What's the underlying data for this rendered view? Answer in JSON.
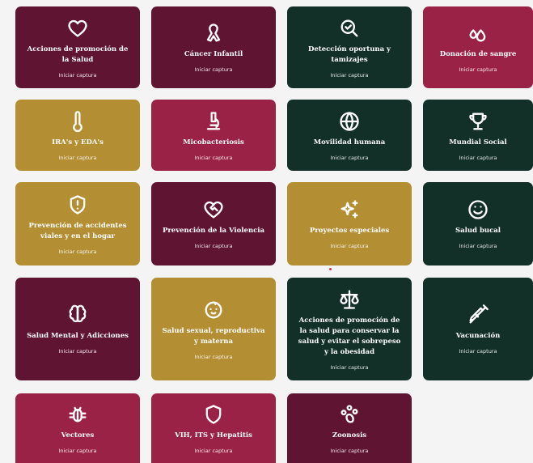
{
  "cards": [
    {
      "title": "Acciones de promoción de la Salud",
      "cta": "Iniciar captura",
      "icon": "heart-icon",
      "color": "#5f1432"
    },
    {
      "title": "Cáncer Infantil",
      "cta": "Iniciar captura",
      "icon": "ribbon-icon",
      "color": "#5f1432"
    },
    {
      "title": "Detección oportuna y tamizajes",
      "cta": "Iniciar captura",
      "icon": "search-check-icon",
      "color": "#133028"
    },
    {
      "title": "Donación de sangre",
      "cta": "Iniciar captura",
      "icon": "droplets-icon",
      "color": "#9b2247"
    },
    {
      "title": "IRA's y EDA's",
      "cta": "Iniciar captura",
      "icon": "thermometer-icon",
      "color": "#b38e33"
    },
    {
      "title": "Micobacteriosis",
      "cta": "Iniciar captura",
      "icon": "microscope-icon",
      "color": "#9b2247"
    },
    {
      "title": "Movilidad humana",
      "cta": "Iniciar captura",
      "icon": "globe-icon",
      "color": "#133028"
    },
    {
      "title": "Mundial Social",
      "cta": "Iniciar captura",
      "icon": "trophy-icon",
      "color": "#133028"
    },
    {
      "title": "Prevención de accidentes viales y en el hogar",
      "cta": "Iniciar captura",
      "icon": "shield-alert-icon",
      "color": "#b38e33"
    },
    {
      "title": "Prevención de la Violencia",
      "cta": "Iniciar captura",
      "icon": "heart-handshake-icon",
      "color": "#5f1432"
    },
    {
      "title": "Proyectos especiales",
      "cta": "Iniciar captura",
      "icon": "sparkles-icon",
      "color": "#b38e33"
    },
    {
      "title": "Salud bucal",
      "cta": "Iniciar captura",
      "icon": "smile-icon",
      "color": "#133028"
    },
    {
      "title": "Salud Mental y Adicciones",
      "cta": "Iniciar captura",
      "icon": "brain-icon",
      "color": "#5f1432"
    },
    {
      "title": "Salud sexual, reproductiva y materna",
      "cta": "Iniciar captura",
      "icon": "baby-icon",
      "color": "#b38e33"
    },
    {
      "title": "Acciones de promoción de la salud para conservar la salud y evitar el sobrepeso y la obesidad",
      "cta": "Iniciar captura",
      "icon": "scale-icon",
      "color": "#133028"
    },
    {
      "title": "Vacunación",
      "cta": "Iniciar captura",
      "icon": "syringe-icon",
      "color": "#133028"
    },
    {
      "title": "Vectores",
      "cta": "Iniciar captura",
      "icon": "bug-icon",
      "color": "#9b2247"
    },
    {
      "title": "VIH, ITS y Hepatitis",
      "cta": "Iniciar captura",
      "icon": "shield-icon",
      "color": "#9b2247"
    },
    {
      "title": "Zoonosis",
      "cta": "Iniciar captura",
      "icon": "paw-icon",
      "color": "#5f1432"
    }
  ]
}
